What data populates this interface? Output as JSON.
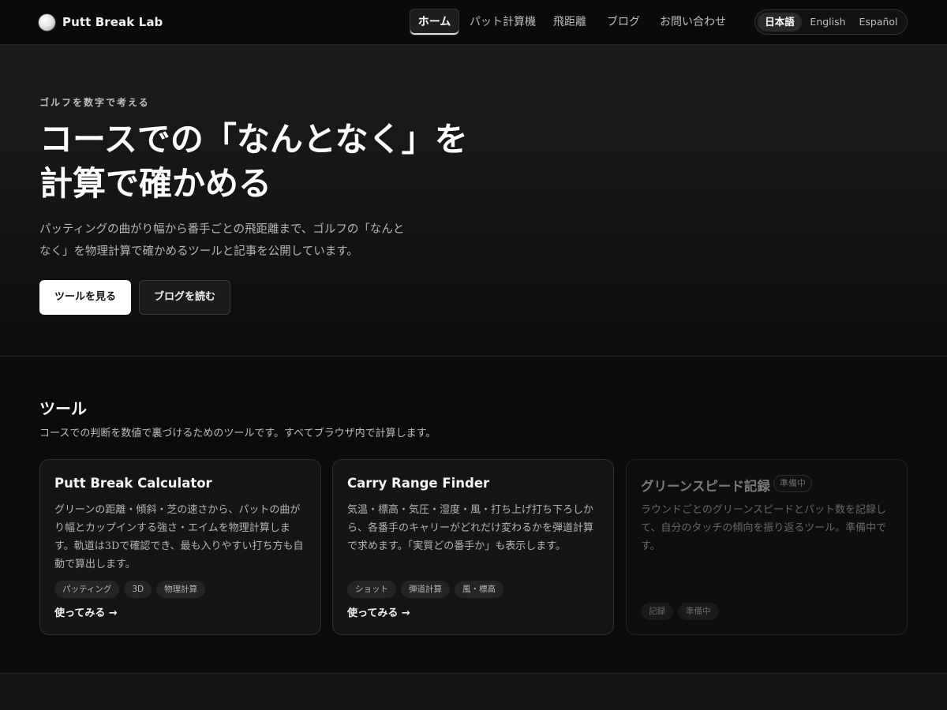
{
  "header": {
    "logo_text": "Putt Break Lab",
    "nav": [
      {
        "label": "ホーム",
        "active": true
      },
      {
        "label": "パット計算機",
        "active": false
      },
      {
        "label": "飛距離",
        "active": false
      },
      {
        "label": "ブログ",
        "active": false
      },
      {
        "label": "お問い合わせ",
        "active": false
      }
    ],
    "languages": [
      {
        "label": "日本語",
        "active": true
      },
      {
        "label": "English",
        "active": false
      },
      {
        "label": "Español",
        "active": false
      }
    ]
  },
  "hero": {
    "eyebrow": "ゴルフを数字で考える",
    "title_line1": "コースでの「なんとなく」を",
    "title_line2": "計算で確かめる",
    "desc_line1": "パッティングの曲がり幅から番手ごとの飛距離まで、ゴルフの「なんと",
    "desc_line2": "なく」を物理計算で確かめるツールと記事を公開しています。",
    "primary_button": "ツールを見る",
    "secondary_button": "ブログを読む"
  },
  "tools": {
    "title": "ツール",
    "description": "コースでの判断を数値で裏づけるためのツールです。すべてブラウザ内で計算します。",
    "cards": [
      {
        "title": "Putt Break Calculator",
        "desc_lines": [
          "グリーンの距離・傾斜・芝の速さから、パットの曲が",
          "り幅とカップインする強さ・エイムを物理計算しま",
          "す。軌道は3Dで確認でき、最も入りやすい打ち方も自",
          "動で算出します。"
        ],
        "tags": [
          "パッティング",
          "3D",
          "物理計算"
        ],
        "link": "使ってみる →"
      },
      {
        "title": "Carry Range Finder",
        "desc_lines": [
          "気温・標高・気圧・湿度・風・打ち上げ打ち下ろしか",
          "ら、各番手のキャリーがどれだけ変わるかを弾道計算",
          "で求めます。「実質どの番手か」も表示します。"
        ],
        "tags": [
          "ショット",
          "弾道計算",
          "風・標高"
        ],
        "link": "使ってみる →"
      },
      {
        "title": "グリーンスピード記録",
        "badge": "準備中",
        "desc_lines": [
          "ラウンドごとのグリーンスピードとパット数を記録し",
          "て、自分のタッチの傾向を振り返るツール。準備中で",
          "す。"
        ],
        "tags": [
          "記録",
          "準備中"
        ]
      }
    ]
  }
}
